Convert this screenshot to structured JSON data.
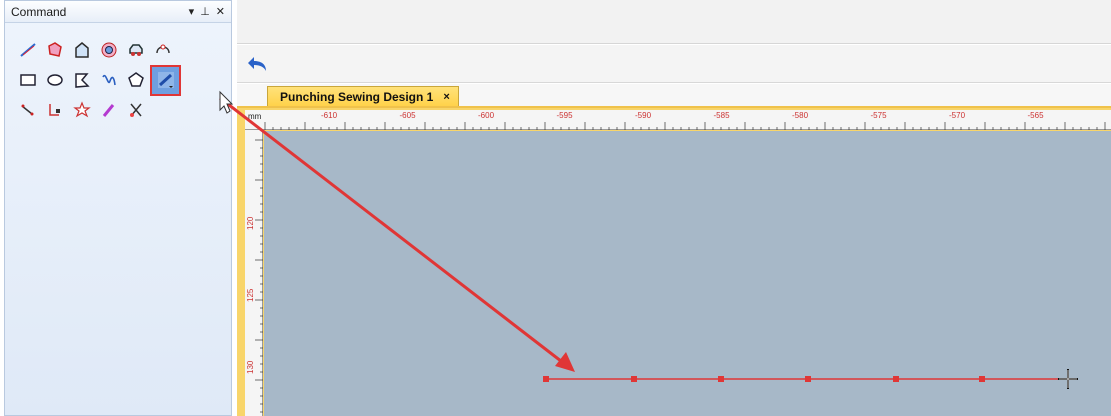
{
  "command_panel": {
    "title": "Command",
    "controls": {
      "dropdown": "▾",
      "pin": "⊥",
      "close": "✕"
    },
    "tools": [
      [
        "line-tool-icon",
        "polygon-node-icon",
        "house-shape-icon",
        "target-icon",
        "car-shape-icon",
        "link-nodes-icon"
      ],
      [
        "rectangle-icon",
        "ellipse-icon",
        "polyline-shape-icon",
        "curve-icon",
        "pentagon-icon",
        "punching-tool-icon"
      ],
      [
        "point-tool-icon",
        "node-edit-icon",
        "star-node-icon",
        "pen-icon",
        "scissors-icon"
      ]
    ],
    "selected_tool": "punching-tool-icon"
  },
  "document": {
    "tab_title": "Punching Sewing Design 1",
    "tab_close": "×",
    "ruler_unit": "mm",
    "top_ruler_labels": [
      "-610",
      "-605",
      "-600",
      "-595",
      "-590",
      "-585",
      "-580",
      "-575",
      "-570",
      "-565"
    ],
    "left_ruler_labels": [
      "120",
      "125",
      "130"
    ]
  },
  "colors": {
    "accent_red": "#e03636",
    "canvas": "#a7b8c8",
    "tab_yellow": "#ffd24a"
  }
}
